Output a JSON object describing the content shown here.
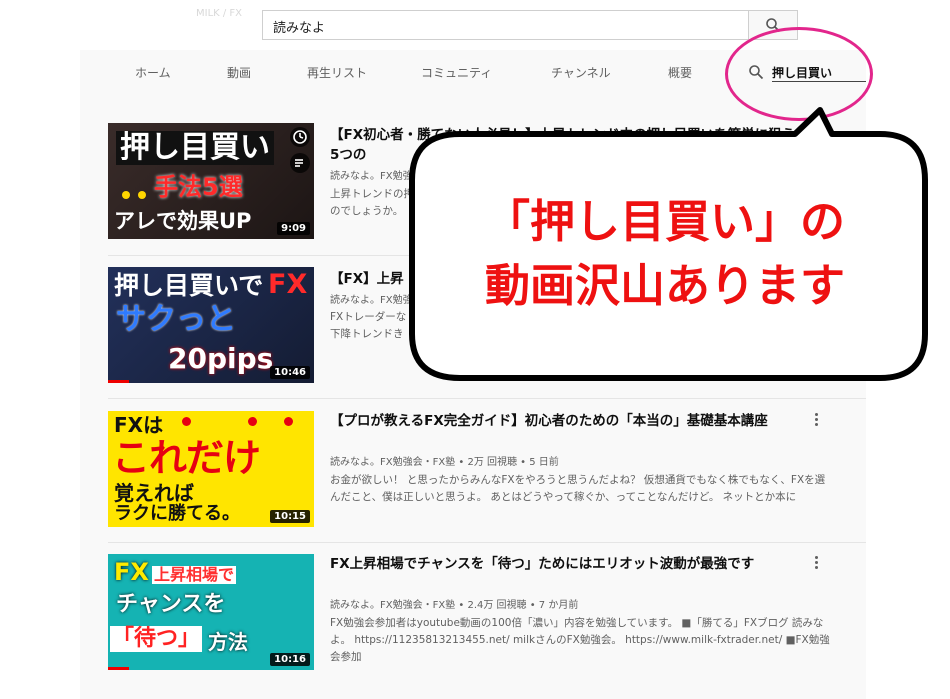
{
  "header": {
    "top_hint": "MILK / FX",
    "search_value": "読みなよ"
  },
  "nav": {
    "tabs": [
      "ホーム",
      "動画",
      "再生リスト",
      "コミュニティ",
      "チャンネル",
      "概要"
    ],
    "search_value": "押し目買い"
  },
  "videos": [
    {
      "title": "【FX初心者・勝てない人必見！】上昇トレンド中の押し目買いを簡単に狙う5つの",
      "meta": "読みなよ。FX勉強",
      "desc": "上昇トレンドの押\nのでしょうか。",
      "duration": "9:09",
      "thumb_lines": [
        "押し目買い",
        "手法5選",
        "アレで効果UP"
      ],
      "progress": 0
    },
    {
      "title": "【FX】上昇",
      "meta": "読みなよ。FX勉強",
      "desc": "FXトレーダーな\n下降トレンドき",
      "duration": "10:46",
      "thumb_lines": [
        "押し目買いで",
        "FX",
        "サクっと",
        "20pips"
      ],
      "progress": 0.1
    },
    {
      "title": "【プロが教えるFX完全ガイド】初心者のための「本当の」基礎基本講座",
      "meta": "読みなよ。FX勉強会・FX塾 • 2万 回視聴 • 5 日前",
      "desc": "お金が欲しい！ と思ったからみんなFXをやろうと思うんだよね？ 仮想通貨でもなく株でもなく、FXを選んだこと、僕は正しいと思うよ。 あとはどうやって稼ぐか、ってことなんだけど。 ネットとか本に",
      "duration": "10:15",
      "thumb_lines": [
        "FXは",
        "これだけ",
        "覚えれば",
        "ラクに勝てる。"
      ],
      "progress": 0
    },
    {
      "title": "FX上昇相場でチャンスを「待つ」ためにはエリオット波動が最強です",
      "meta": "読みなよ。FX勉強会・FX塾 • 2.4万 回視聴 • 7 か月前",
      "desc": "FX勉強会参加者はyoutube動画の100倍「濃い」内容を勉強しています。 ■「勝てる」FXブログ 読みなよ。 https://11235813213455.net/ milkさんのFX勉強会。 https://www.milk-fxtrader.net/ ■FX勉強会参加",
      "duration": "10:16",
      "thumb_lines": [
        "FX",
        "上昇相場で",
        "チャンスを",
        "「待つ」",
        "方法"
      ],
      "progress": 0.1
    }
  ],
  "callout": {
    "line1": "「押し目買い」の",
    "line2": "動画沢山あります"
  },
  "colors": {
    "highlight_circle": "#e2268c",
    "callout_text": "#ee1111"
  }
}
